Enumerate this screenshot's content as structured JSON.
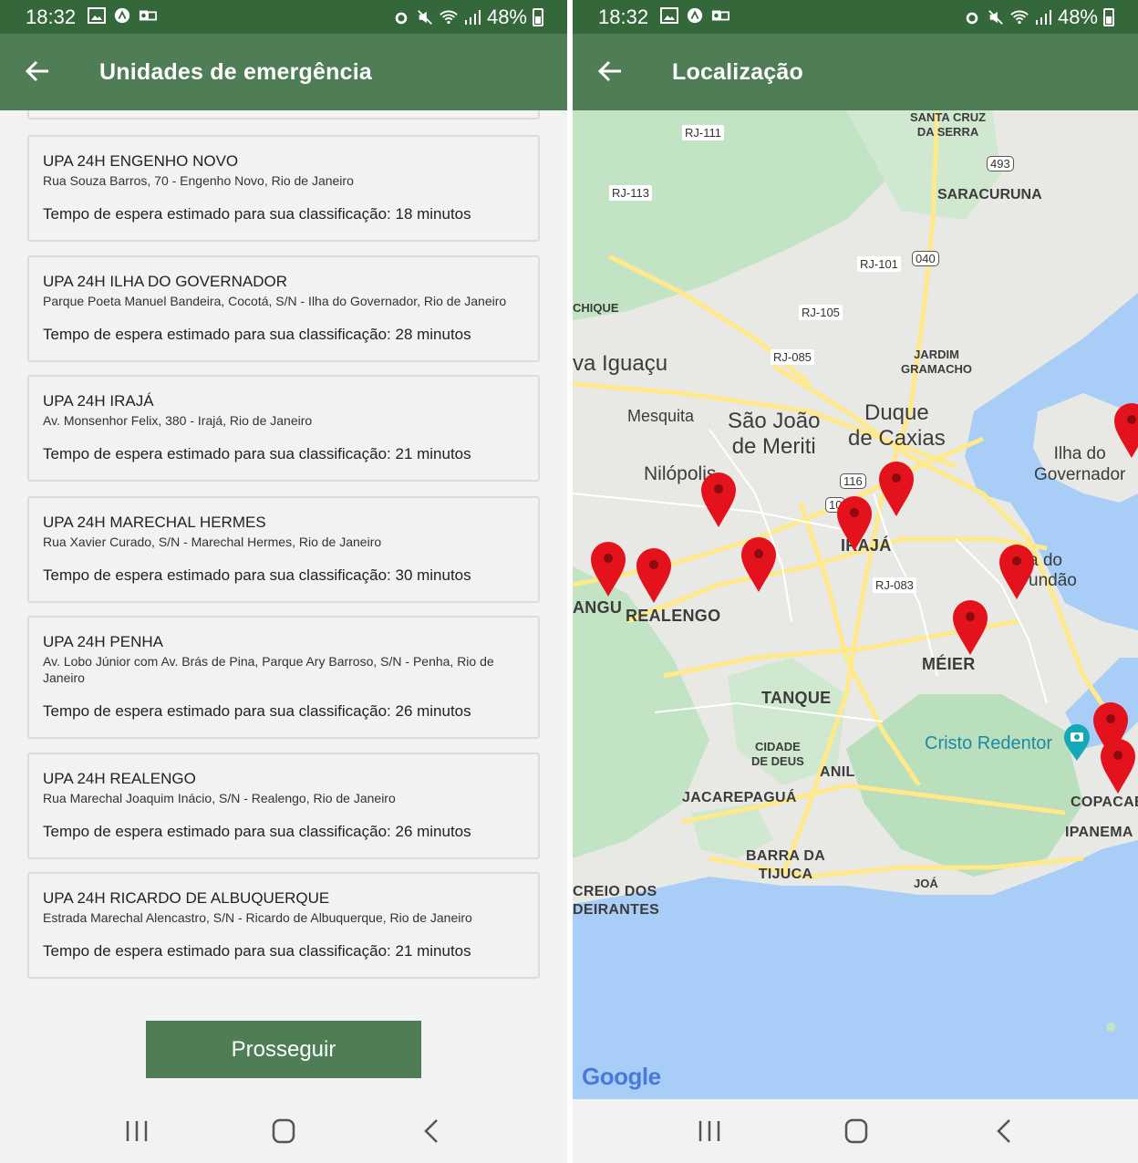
{
  "status_bar": {
    "time": "18:32",
    "battery": "48%"
  },
  "left_screen": {
    "title": "Unidades de emergência",
    "units": [
      {
        "name": "UPA 24H ENGENHO NOVO",
        "address": "Rua Souza Barros, 70 - Engenho Novo, Rio de Janeiro",
        "wait": "Tempo de espera estimado para sua classificação: 18 minutos"
      },
      {
        "name": "UPA 24H ILHA DO GOVERNADOR",
        "address": "Parque Poeta Manuel Bandeira, Cocotá, S/N - Ilha do Governador, Rio de Janeiro",
        "wait": "Tempo de espera estimado para sua classificação: 28 minutos"
      },
      {
        "name": "UPA 24H IRAJÁ",
        "address": "Av. Monsenhor Felix, 380 - Irajá, Rio de Janeiro",
        "wait": "Tempo de espera estimado para sua classificação: 21 minutos"
      },
      {
        "name": "UPA 24H MARECHAL HERMES",
        "address": "Rua Xavier Curado, S/N - Marechal Hermes, Rio de Janeiro",
        "wait": "Tempo de espera estimado para sua classificação: 30 minutos"
      },
      {
        "name": "UPA 24H PENHA",
        "address": "Av. Lobo Júnior com Av. Brás de Pina, Parque Ary Barroso, S/N - Penha, Rio de Janeiro",
        "wait": "Tempo de espera estimado para sua classificação: 26 minutos"
      },
      {
        "name": "UPA 24H REALENGO",
        "address": "Rua Marechal Joaquim Inácio, S/N - Realengo, Rio de Janeiro",
        "wait": "Tempo de espera estimado para sua classificação: 26 minutos"
      },
      {
        "name": "UPA 24H RICARDO DE ALBUQUERQUE",
        "address": "Estrada Marechal Alencastro, S/N - Ricardo de Albuquerque, Rio de Janeiro",
        "wait": "Tempo de espera estimado para sua classificação: 21 minutos"
      }
    ],
    "proceed_button": "Prosseguir"
  },
  "right_screen": {
    "title": "Localização",
    "map_labels": {
      "santa_cruz": "SANTA CRUZ\nDA SERRA",
      "saracuruna": "SARACURUNA",
      "chique": "CHIQUE",
      "iguacu": "va Iguaçu",
      "jardim": "JARDIM\nGRAMACHO",
      "mesquita": "Mesquita",
      "sao_joao": "São João\nde Meriti",
      "duque": "Duque\nde Caxias",
      "nilopolis": "Nilópolis",
      "ilha": "Ilha do\nGovernador",
      "iraja": "IRAJÁ",
      "fundao": "a do\nundão",
      "angu": "ANGU",
      "realengo": "REALENGO",
      "meier": "MÉIER",
      "tanque": "TANQUE",
      "cristo": "Cristo Redentor",
      "cidade_deus": "CIDADE\nDE DEUS",
      "anil": "ANIL",
      "jacarepagua": "JACAREPAGUÁ",
      "copacabana": "COPACAB",
      "ipanema": "IPANEMA",
      "barra": "BARRA DA\nTIJUCA",
      "joa": "JOÁ",
      "recreio": "CREIO DOS\nDEIRANTES",
      "google": "Google"
    },
    "roads": {
      "rj111": "RJ-111",
      "rj113": "RJ-113",
      "rj101": "RJ-101",
      "rj105": "RJ-105",
      "rj085": "RJ-085",
      "rj083": "RJ-083",
      "s493": "493",
      "s040": "040",
      "s116": "116",
      "s10": "10"
    }
  },
  "colors": {
    "status_bar": "#34683a",
    "app_bar": "#4e7d56",
    "button": "#4e7d56",
    "pin": "#e3121c",
    "water": "#a8cdf6",
    "land": "#e8e8e4",
    "green": "#c2e3c4",
    "road": "#ffe98a"
  }
}
